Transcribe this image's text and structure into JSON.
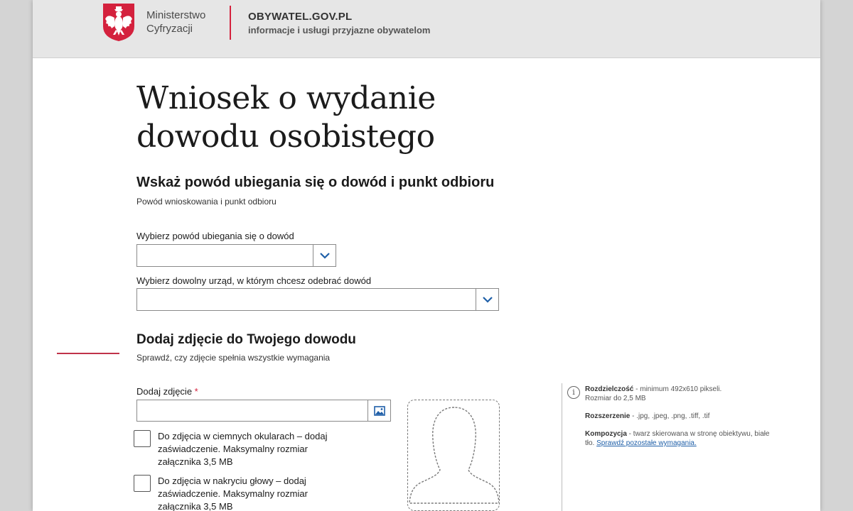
{
  "header": {
    "ministry_line1": "Ministerstwo",
    "ministry_line2": "Cyfryzacji",
    "site_name": "OBYWATEL.GOV.PL",
    "site_tagline": "informacje i usługi przyjazne obywatelom"
  },
  "page": {
    "title_line1": "Wniosek o wydanie",
    "title_line2": "dowodu osobistego"
  },
  "section_reason": {
    "heading": "Wskaż powód ubiegania się o dowód i punkt odbioru",
    "subheading": "Powód wnioskowania i punkt odbioru",
    "reason_label": "Wybierz powód ubiegania się o dowód",
    "reason_value": "",
    "office_label": "Wybierz dowolny urząd, w którym chcesz odebrać dowód",
    "office_value": ""
  },
  "section_photo": {
    "heading": "Dodaj zdjęcie do Twojego dowodu",
    "subheading": "Sprawdź, czy zdjęcie spełnia wszystkie wymagania",
    "photo_label": "Dodaj zdjęcie",
    "required_mark": "*",
    "checkbox_glasses": "Do zdjęcia w ciemnych okularach – dodaj zaświadczenie. Maksymalny rozmiar załącznika 3,5 MB",
    "checkbox_glasses_checked": false,
    "checkbox_headwear": "Do zdjęcia w nakryciu głowy – dodaj zaświadczenie. Maksymalny rozmiar załącznika 3,5 MB",
    "checkbox_headwear_checked": false
  },
  "info": {
    "icon": "info-icon",
    "resolution_title": "Rozdzielczość",
    "resolution_text": " - minimum 492x610 pikseli.",
    "size_text": "Rozmiar do 2,5 MB",
    "extension_title": "Rozszerzenie",
    "extension_text": " - .jpg, .jpeg, .png, .tiff, .tif",
    "composition_title": "Kompozycja",
    "composition_text": " - twarz skierowana w stronę obiektywu, białe tło. ",
    "requirements_link": "Sprawdź pozostałe wymagania."
  },
  "colors": {
    "accent_red": "#d4213d",
    "link_blue": "#1f5fa8",
    "header_bg": "#e6e6e6"
  }
}
